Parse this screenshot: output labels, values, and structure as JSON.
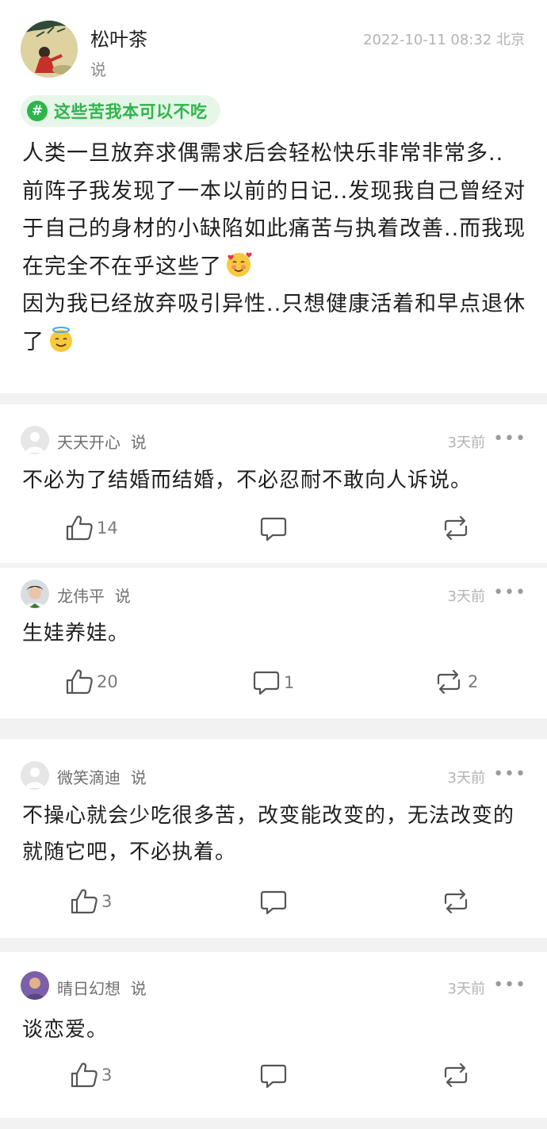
{
  "post": {
    "author": "松叶茶",
    "says": "说",
    "time": "2022-10-11 08:32 北京",
    "topic_hash": "#",
    "topic": "这些苦我本可以不吃",
    "lines": [
      "人类一旦放弃求偶需求后会轻松快乐非常非常多..",
      "前阵子我发现了一本以前的日记..发现我自己曾经对于自己的身材的小缺陷如此痛苦与执着改善..而我现在完全不在乎这些了",
      "因为我已经放弃吸引异性..只想健康活着和早点退休了"
    ],
    "emojis": [
      "smiling-face-with-hearts",
      "smiling-face-with-halo"
    ]
  },
  "comments": [
    {
      "name": "天天开心",
      "says": "说",
      "time": "3天前",
      "more": "•••",
      "text": "不必为了结婚而结婚，不必忍耐不敢向人诉说。",
      "likes": "14",
      "replies": "",
      "reposts": ""
    },
    {
      "name": "龙伟平",
      "says": "说",
      "time": "3天前",
      "more": "•••",
      "text": "生娃养娃。",
      "likes": "20",
      "replies": "1",
      "reposts": "2"
    },
    {
      "name": "微笑滴迪",
      "says": "说",
      "time": "3天前",
      "more": "•••",
      "text": "不操心就会少吃很多苦，改变能改变的，无法改变的就随它吧，不必执着。",
      "likes": "3",
      "replies": "",
      "reposts": ""
    },
    {
      "name": "晴日幻想",
      "says": "说",
      "time": "3天前",
      "more": "•••",
      "text": "谈恋爱。",
      "likes": "3",
      "replies": "",
      "reposts": ""
    }
  ],
  "colors": {
    "accent": "#2eb54a",
    "tag_bg": "#e6f6e9",
    "muted": "#b3b3b3",
    "divider": "#f2f2f2"
  }
}
